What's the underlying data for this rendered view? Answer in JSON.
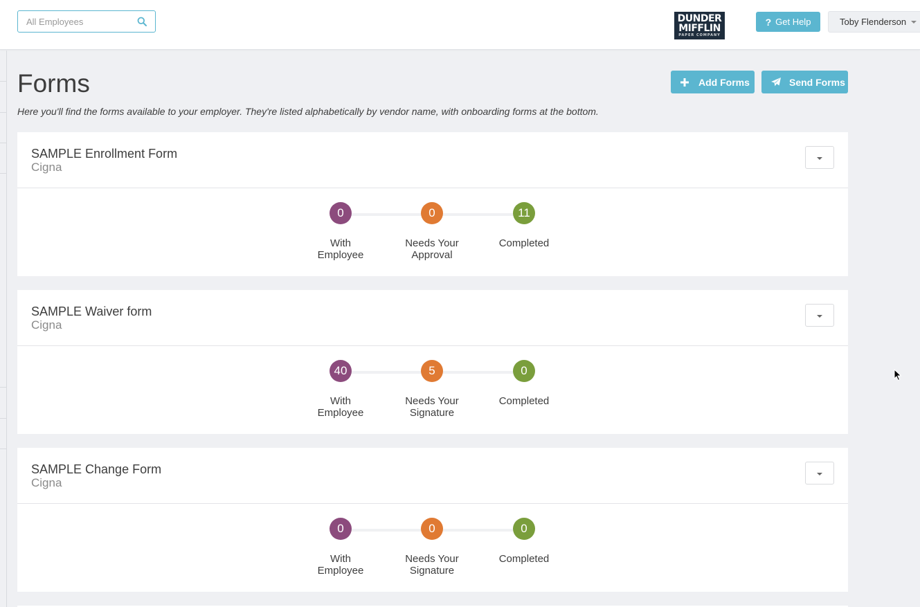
{
  "header": {
    "search": {
      "placeholder": "All Employees",
      "icon": "search-icon"
    },
    "logo": {
      "line1": "DUNDER",
      "line2": "MIFFLIN",
      "line3": "PAPER COMPANY"
    },
    "help_label": "Get Help",
    "user_name": "Toby Flenderson"
  },
  "page": {
    "title": "Forms",
    "description": "Here you'll find the forms available to your employer. They're listed alphabetically by vendor name, with onboarding forms at the bottom.",
    "add_forms_label": "Add Forms",
    "send_forms_label": "Send Forms"
  },
  "colors": {
    "accent": "#5bb6d0",
    "with_employee": "#8c4b7d",
    "needs_action": "#e07a33",
    "completed": "#7a9e3c"
  },
  "forms": [
    {
      "title": "SAMPLE Enrollment Form",
      "vendor": "Cigna",
      "steps": [
        {
          "count": "0",
          "label_line1": "With",
          "label_line2": "Employee"
        },
        {
          "count": "0",
          "label_line1": "Needs Your",
          "label_line2": "Approval"
        },
        {
          "count": "11",
          "label_line1": "Completed",
          "label_line2": ""
        }
      ]
    },
    {
      "title": "SAMPLE Waiver form",
      "vendor": "Cigna",
      "steps": [
        {
          "count": "40",
          "label_line1": "With",
          "label_line2": "Employee"
        },
        {
          "count": "5",
          "label_line1": "Needs Your",
          "label_line2": "Signature"
        },
        {
          "count": "0",
          "label_line1": "Completed",
          "label_line2": ""
        }
      ]
    },
    {
      "title": "SAMPLE Change Form",
      "vendor": "Cigna",
      "steps": [
        {
          "count": "0",
          "label_line1": "With",
          "label_line2": "Employee"
        },
        {
          "count": "0",
          "label_line1": "Needs Your",
          "label_line2": "Signature"
        },
        {
          "count": "0",
          "label_line1": "Completed",
          "label_line2": ""
        }
      ]
    }
  ]
}
